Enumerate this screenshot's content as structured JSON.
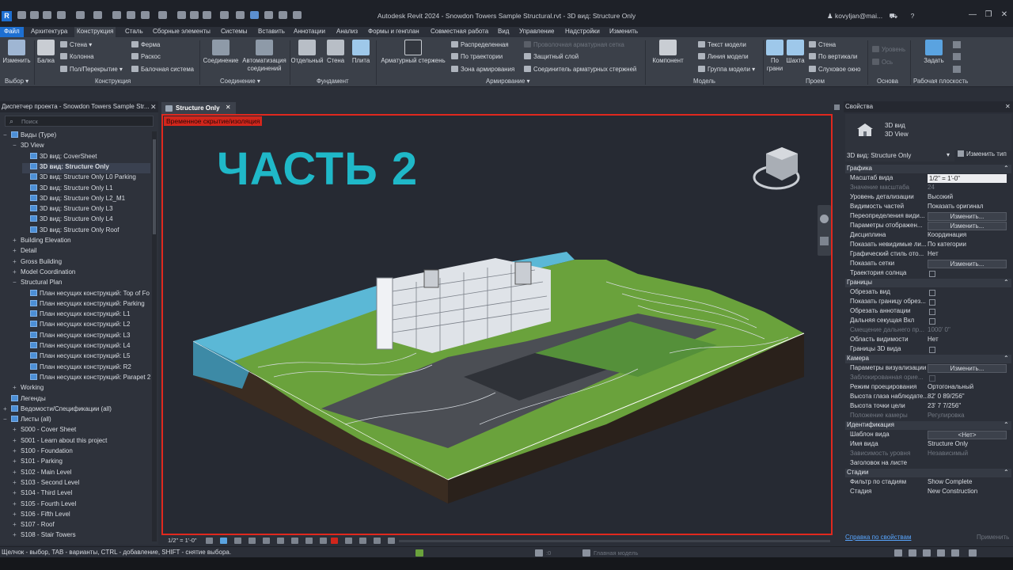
{
  "app": {
    "logo": "R",
    "window_title": "Autodesk Revit 2024 - Snowdon Towers Sample Structural.rvt - 3D вид: Structure Only",
    "user": "kovyljan@mai...",
    "win_min": "—",
    "win_max": "❐",
    "win_close": "✕"
  },
  "menu": {
    "tabs": [
      "Файл",
      "Архитектура",
      "Конструкция",
      "Сталь",
      "Сборные элементы",
      "Системы",
      "Вставить",
      "Аннотации",
      "Анализ",
      "Формы и генплан",
      "Совместная работа",
      "Вид",
      "Управление",
      "Надстройки",
      "Изменить"
    ]
  },
  "ribbon": {
    "modify": "Изменить",
    "beam": "Балка",
    "wall": "Стена",
    "column": "Колонна",
    "floor": "Пол/Перекрытие",
    "truss": "Ферма",
    "brace": "Раскос",
    "beam_system": "Балочная система",
    "connection": "Соединение",
    "auto_conn": "Автоматизация соединений",
    "isolated": "Отдельный",
    "wall_f": "Стена",
    "slab": "Плита",
    "rebar": "Арматурный стержень",
    "area": "Распределенная",
    "path": "По траектории",
    "fabric_area": "Зона армирования",
    "fabric_sheet": "Проволочная арматурная сетка",
    "cover": "Защитный слой",
    "coupler": "Соединитель арматурных стержней",
    "component": "Компонент",
    "model_text": "Текст модели",
    "model_line": "Линия модели",
    "model_group": "Группа модели",
    "by_face": "По грани",
    "shaft": "Шахта",
    "op_wall": "Стена",
    "vertical": "По вертикали",
    "dormer": "Слуховое окно",
    "level": "Уровень",
    "grid": "Ось",
    "set": "Задать",
    "groups": {
      "select": "Выбор",
      "structure": "Конструкция",
      "connection": "Соединение",
      "foundation": "Фундамент",
      "reinforcement": "Армирование",
      "model": "Модель",
      "opening": "Проем",
      "datum": "Основа",
      "workplane": "Рабочая плоскость"
    }
  },
  "browser": {
    "title": "Диспетчер проекта - Snowdon Towers Sample Str...",
    "search_placeholder": "Поиск",
    "nodes": [
      {
        "label": "Виды (Type)",
        "level": 0,
        "ex": "−",
        "icon": true
      },
      {
        "label": "3D View",
        "level": 1,
        "ex": "−",
        "icon": false
      },
      {
        "label": "3D вид: CoverSheet",
        "level": 2,
        "ex": "",
        "icon": true
      },
      {
        "label": "3D вид: Structure Only",
        "level": 2,
        "ex": "",
        "icon": true,
        "bold": true
      },
      {
        "label": "3D вид: Structure Only L0 Parking",
        "level": 2,
        "ex": "",
        "icon": true
      },
      {
        "label": "3D вид: Structure Only L1",
        "level": 2,
        "ex": "",
        "icon": true
      },
      {
        "label": "3D вид: Structure Only L2_M1",
        "level": 2,
        "ex": "",
        "icon": true
      },
      {
        "label": "3D вид: Structure Only L3",
        "level": 2,
        "ex": "",
        "icon": true
      },
      {
        "label": "3D вид: Structure Only L4",
        "level": 2,
        "ex": "",
        "icon": true
      },
      {
        "label": "3D вид: Structure Only Roof",
        "level": 2,
        "ex": "",
        "icon": true
      },
      {
        "label": "Building Elevation",
        "level": 1,
        "ex": "+",
        "icon": false
      },
      {
        "label": "Detail",
        "level": 1,
        "ex": "+",
        "icon": false
      },
      {
        "label": "Gross Building",
        "level": 1,
        "ex": "+",
        "icon": false
      },
      {
        "label": "Model Coordination",
        "level": 1,
        "ex": "+",
        "icon": false
      },
      {
        "label": "Structural Plan",
        "level": 1,
        "ex": "−",
        "icon": false
      },
      {
        "label": "План несущих конструкций: Top of Fo",
        "level": 2,
        "ex": "",
        "icon": true
      },
      {
        "label": "План несущих конструкций: Parking",
        "level": 2,
        "ex": "",
        "icon": true
      },
      {
        "label": "План несущих конструкций: L1",
        "level": 2,
        "ex": "",
        "icon": true
      },
      {
        "label": "План несущих конструкций: L2",
        "level": 2,
        "ex": "",
        "icon": true
      },
      {
        "label": "План несущих конструкций: L3",
        "level": 2,
        "ex": "",
        "icon": true
      },
      {
        "label": "План несущих конструкций: L4",
        "level": 2,
        "ex": "",
        "icon": true
      },
      {
        "label": "План несущих конструкций: L5",
        "level": 2,
        "ex": "",
        "icon": true
      },
      {
        "label": "План несущих конструкций: R2",
        "level": 2,
        "ex": "",
        "icon": true
      },
      {
        "label": "План несущих конструкций: Parapet 2",
        "level": 2,
        "ex": "",
        "icon": true
      },
      {
        "label": "Working",
        "level": 1,
        "ex": "+",
        "icon": false
      },
      {
        "label": "Легенды",
        "level": 0,
        "ex": "",
        "icon": true
      },
      {
        "label": "Ведомости/Спецификации (all)",
        "level": 0,
        "ex": "+",
        "icon": true
      },
      {
        "label": "Листы (all)",
        "level": 0,
        "ex": "−",
        "icon": true
      },
      {
        "label": "S000 - Cover Sheet",
        "level": 1,
        "ex": "+",
        "icon": false
      },
      {
        "label": "S001 - Learn about this project",
        "level": 1,
        "ex": "+",
        "icon": false
      },
      {
        "label": "S100 - Foundation",
        "level": 1,
        "ex": "+",
        "icon": false
      },
      {
        "label": "S101 - Parking",
        "level": 1,
        "ex": "+",
        "icon": false
      },
      {
        "label": "S102 - Main Level",
        "level": 1,
        "ex": "+",
        "icon": false
      },
      {
        "label": "S103 - Second Level",
        "level": 1,
        "ex": "+",
        "icon": false
      },
      {
        "label": "S104 - Third Level",
        "level": 1,
        "ex": "+",
        "icon": false
      },
      {
        "label": "S105 - Fourth Level",
        "level": 1,
        "ex": "+",
        "icon": false
      },
      {
        "label": "S106 - Fifth Level",
        "level": 1,
        "ex": "+",
        "icon": false
      },
      {
        "label": "S107 - Roof",
        "level": 1,
        "ex": "+",
        "icon": false
      },
      {
        "label": "S108 - Stair Towers",
        "level": 1,
        "ex": "+",
        "icon": false
      }
    ]
  },
  "document": {
    "tab_label": "Structure Only",
    "isolation_label": "Временное скрытие/изоляция",
    "overlay_title": "ЧАСТЬ 2",
    "scale": "1/2\" = 1'-0\""
  },
  "properties": {
    "title": "Свойства",
    "type_line1": "3D вид",
    "type_line2": "3D View",
    "view_dropdown": "3D вид: Structure Only",
    "edit_type": "Изменить тип",
    "sections": [
      {
        "name": "Графика",
        "rows": [
          {
            "label": "Масштаб вида",
            "value": "1/2\" = 1'-0\"",
            "kind": "input"
          },
          {
            "label": "Значение масштаба",
            "value": "24",
            "kind": "off"
          },
          {
            "label": "Уровень детализации",
            "value": "Высокий",
            "kind": "text"
          },
          {
            "label": "Видимость частей",
            "value": "Показать оригинал",
            "kind": "text"
          },
          {
            "label": "Переопределения види...",
            "value": "Изменить...",
            "kind": "button"
          },
          {
            "label": "Параметры отображен...",
            "value": "Изменить...",
            "kind": "button"
          },
          {
            "label": "Дисциплина",
            "value": "Координация",
            "kind": "text"
          },
          {
            "label": "Показать невидимые ли...",
            "value": "По категории",
            "kind": "text"
          },
          {
            "label": "Графический стиль ото...",
            "value": "Нет",
            "kind": "text"
          },
          {
            "label": "Показать сетки",
            "value": "Изменить...",
            "kind": "button"
          },
          {
            "label": "Траектория солнца",
            "value": "",
            "kind": "check"
          }
        ]
      },
      {
        "name": "Границы",
        "rows": [
          {
            "label": "Обрезать вид",
            "value": "",
            "kind": "check"
          },
          {
            "label": "Показать границу обрез...",
            "value": "",
            "kind": "check"
          },
          {
            "label": "Обрезать аннотации",
            "value": "",
            "kind": "check"
          },
          {
            "label": "Дальняя секущая Вкл",
            "value": "",
            "kind": "check"
          },
          {
            "label": "Смещение дальнего пр...",
            "value": "1000' 0\"",
            "kind": "off"
          },
          {
            "label": "Область видимости",
            "value": "Нет",
            "kind": "text"
          },
          {
            "label": "Границы 3D вида",
            "value": "",
            "kind": "check"
          }
        ]
      },
      {
        "name": "Камера",
        "rows": [
          {
            "label": "Параметры визуализации",
            "value": "Изменить...",
            "kind": "button"
          },
          {
            "label": "Заблокированная орие...",
            "value": "",
            "kind": "offcheck"
          },
          {
            "label": "Режим проецирования",
            "value": "Ортогональный",
            "kind": "text"
          },
          {
            "label": "Высота глаза наблюдате...",
            "value": "82' 0 89/256\"",
            "kind": "text"
          },
          {
            "label": "Высота точки цели",
            "value": "23' 7 7/256\"",
            "kind": "text"
          },
          {
            "label": "Положение камеры",
            "value": "Регулировка",
            "kind": "off"
          }
        ]
      },
      {
        "name": "Идентификация",
        "rows": [
          {
            "label": "Шаблон вида",
            "value": "<Нет>",
            "kind": "button"
          },
          {
            "label": "Имя вида",
            "value": "Structure Only",
            "kind": "text"
          },
          {
            "label": "Зависимость уровня",
            "value": "Независимый",
            "kind": "off"
          },
          {
            "label": "Заголовок на листе",
            "value": "",
            "kind": "text"
          }
        ]
      },
      {
        "name": "Стадии",
        "rows": [
          {
            "label": "Фильтр по стадиям",
            "value": "Show Complete",
            "kind": "text"
          },
          {
            "label": "Стадия",
            "value": "New Construction",
            "kind": "text"
          }
        ]
      }
    ],
    "help_link": "Справка по свойствам",
    "apply": "Применить"
  },
  "status": {
    "hint": "Щелчок - выбор, TAB - варианты, CTRL - добавление, SHIFT - снятие выбора.",
    "zero": ":0",
    "model": "Главная модель"
  },
  "colors": {
    "accent": "#1fb8c8",
    "isolation": "#e0281e",
    "revit_blue": "#1d6fd1",
    "terrain": "#6aa23c",
    "water": "#5bb8d6"
  }
}
